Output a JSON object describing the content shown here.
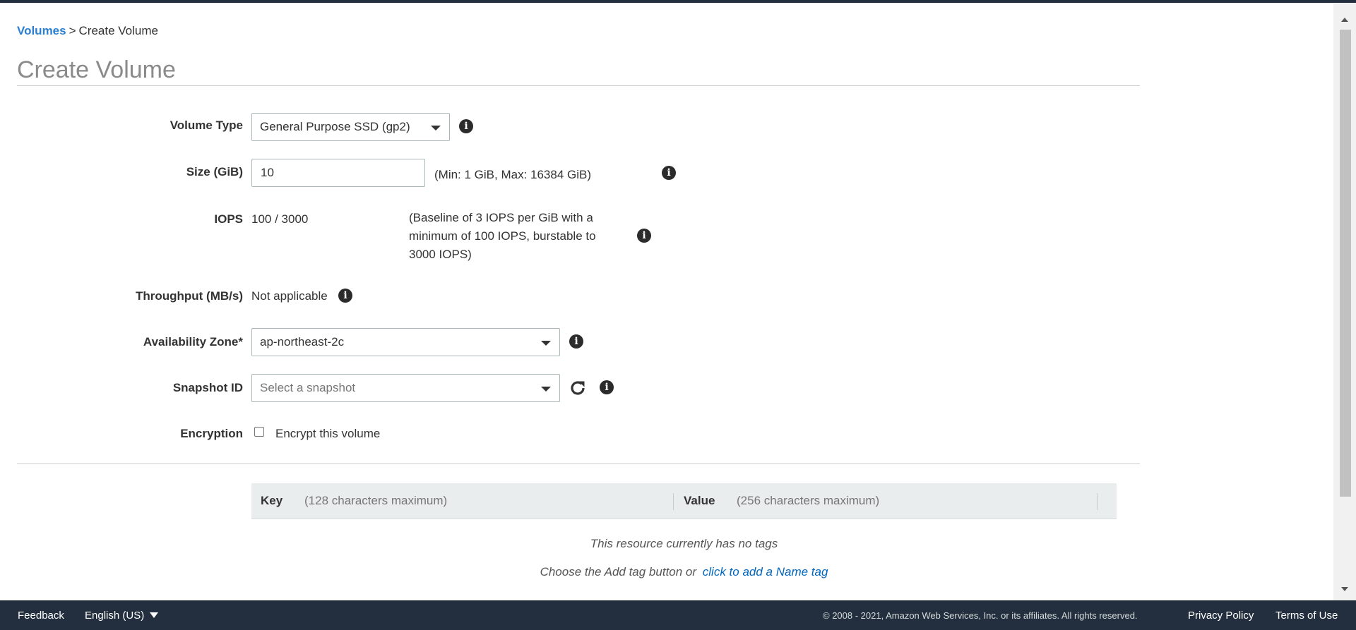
{
  "breadcrumb": {
    "parent": "Volumes",
    "separator": ">",
    "current": "Create Volume"
  },
  "page_title": "Create Volume",
  "form": {
    "volume_type": {
      "label": "Volume Type",
      "value": "General Purpose SSD (gp2)"
    },
    "size": {
      "label": "Size (GiB)",
      "value": "10",
      "hint": "(Min: 1 GiB, Max: 16384 GiB)"
    },
    "iops": {
      "label": "IOPS",
      "value": "100 / 3000",
      "hint_line1": "(Baseline of 3 IOPS per GiB with a",
      "hint_line2": "minimum of 100 IOPS, burstable to",
      "hint_line3": "3000 IOPS)"
    },
    "throughput": {
      "label": "Throughput (MB/s)",
      "value": "Not applicable"
    },
    "availability_zone": {
      "label": "Availability Zone*",
      "value": "ap-northeast-2c"
    },
    "snapshot": {
      "label": "Snapshot ID",
      "placeholder": "Select a snapshot"
    },
    "encryption": {
      "label": "Encryption",
      "checkbox_label": "Encrypt this volume",
      "checked": false
    }
  },
  "tags": {
    "key_header": "Key",
    "key_hint": "(128 characters maximum)",
    "value_header": "Value",
    "value_hint": "(256 characters maximum)",
    "empty_message": "This resource currently has no tags",
    "add_prompt": "Choose the Add tag button or",
    "add_link": "click to add a Name tag"
  },
  "footer": {
    "feedback": "Feedback",
    "language": "English (US)",
    "copyright": "© 2008 - 2021, Amazon Web Services, Inc. or its affiliates. All rights reserved.",
    "privacy": "Privacy Policy",
    "terms": "Terms of Use"
  },
  "icons": {
    "info": "info-icon",
    "refresh": "refresh-icon",
    "caret": "chevron-down-icon"
  },
  "colors": {
    "link": "#2c7fd1",
    "footer_bg": "#232f3e",
    "title": "#8a8a8a"
  }
}
